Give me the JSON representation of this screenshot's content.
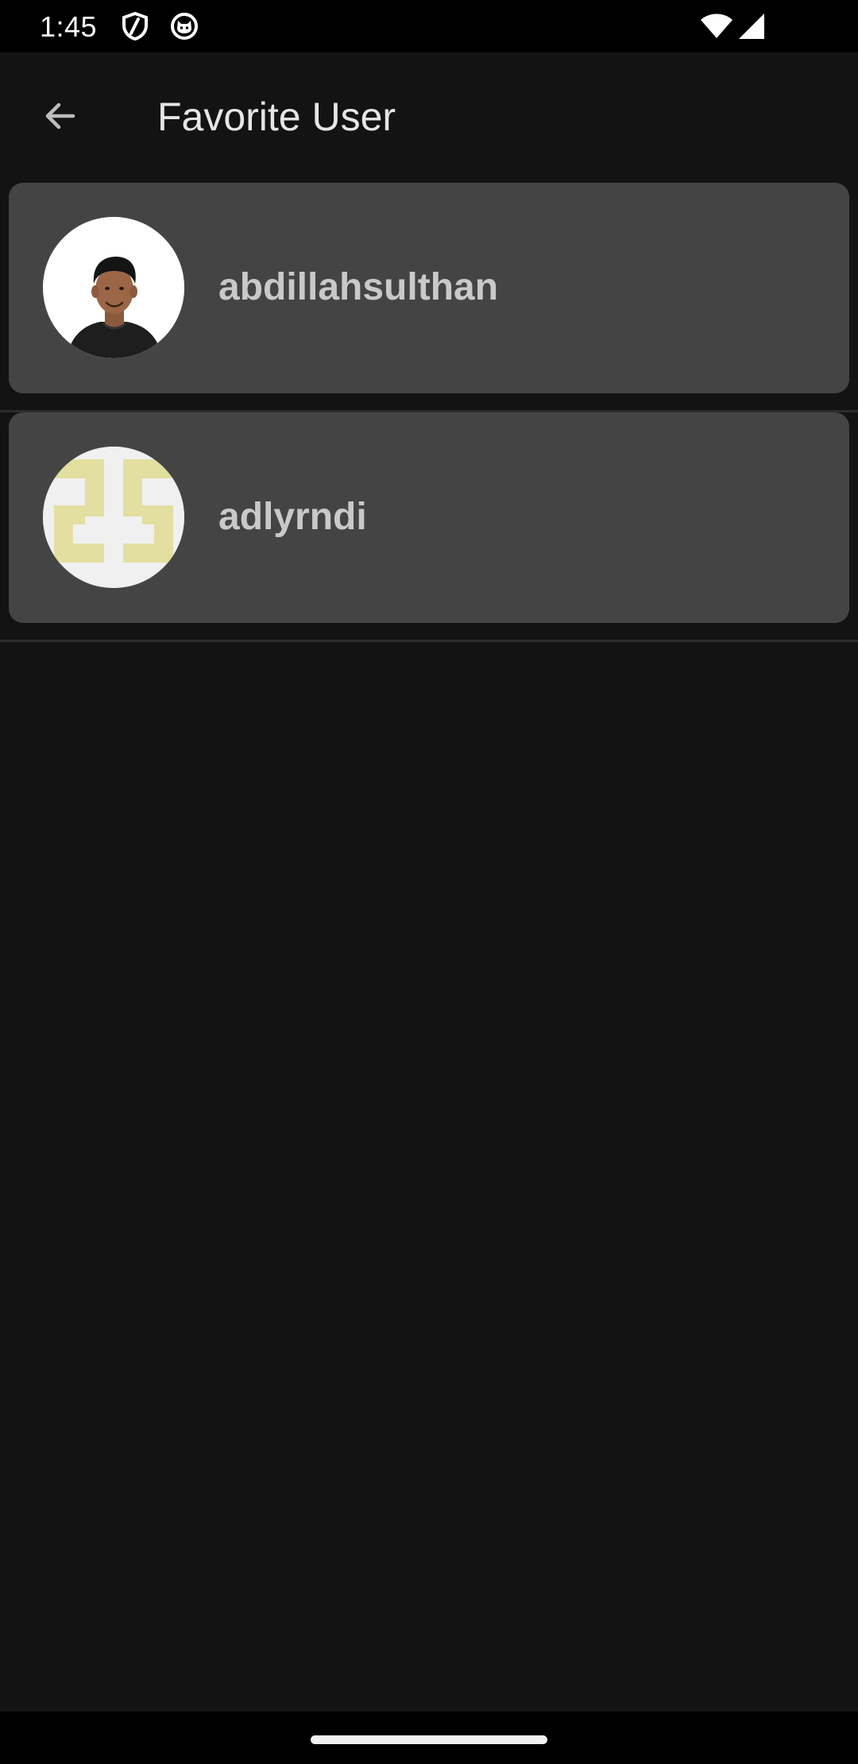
{
  "status_bar": {
    "time": "1:45",
    "icons": [
      "shield-icon",
      "cat-icon",
      "wifi-icon",
      "cellular-signal-icon"
    ]
  },
  "app_bar": {
    "back_icon": "arrow-back-icon",
    "title": "Favorite User"
  },
  "favorites": [
    {
      "username": "abdillahsulthan",
      "avatar": "profile-photo"
    },
    {
      "username": "adlyrndi",
      "avatar": "identicon"
    }
  ],
  "colors": {
    "background": "#131313",
    "card": "#444444",
    "username_text": "#c9c9c9",
    "title_text": "#e6e6e6",
    "identicon": "#e3dfa0",
    "identicon_bg": "#f0f0f0"
  }
}
